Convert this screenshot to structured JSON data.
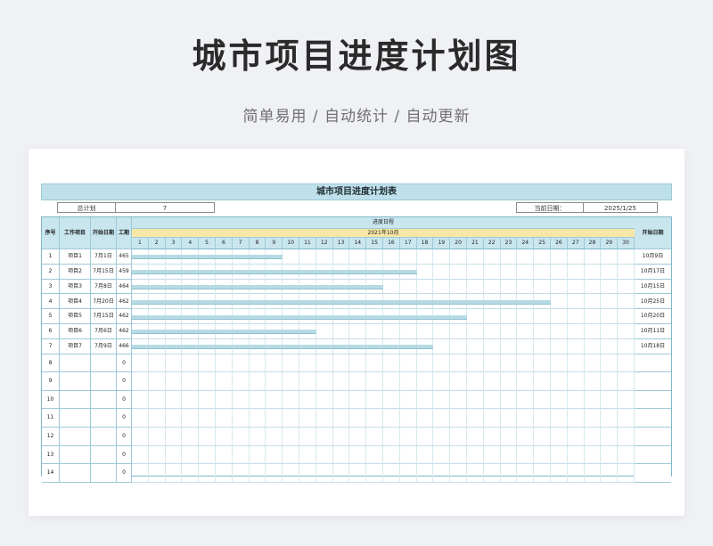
{
  "hero": {
    "title": "城市项目进度计划图",
    "subtitle": "简单易用 / 自动统计 / 自动更新"
  },
  "sheet": {
    "title": "城市项目进度计划表",
    "total_label": "总计划",
    "total_value": "7",
    "current_date_label": "当前日期：",
    "current_date_value": "2025/1/25"
  },
  "table": {
    "headers": {
      "seq": "序号",
      "task": "工作项目",
      "start": "开始日期",
      "duration": "工期",
      "progress": "进度日程",
      "month": "2021年10月",
      "end": "开始日期"
    },
    "days": [
      "1",
      "2",
      "3",
      "4",
      "5",
      "6",
      "7",
      "8",
      "9",
      "10",
      "11",
      "12",
      "13",
      "14",
      "15",
      "16",
      "17",
      "18",
      "19",
      "20",
      "21",
      "22",
      "23",
      "24",
      "25",
      "26",
      "27",
      "28",
      "29",
      "30"
    ],
    "rows": [
      {
        "seq": "1",
        "task": "项目1",
        "start": "7月1日",
        "duration": "465",
        "end": "10月9日",
        "bar_start": 1,
        "bar_end": 9
      },
      {
        "seq": "2",
        "task": "项目2",
        "start": "7月15日",
        "duration": "459",
        "end": "10月17日",
        "bar_start": 1,
        "bar_end": 17
      },
      {
        "seq": "3",
        "task": "项目3",
        "start": "7月8日",
        "duration": "464",
        "end": "10月15日",
        "bar_start": 1,
        "bar_end": 15
      },
      {
        "seq": "4",
        "task": "项目4",
        "start": "7月20日",
        "duration": "462",
        "end": "10月25日",
        "bar_start": 1,
        "bar_end": 25
      },
      {
        "seq": "5",
        "task": "项目5",
        "start": "7月15日",
        "duration": "462",
        "end": "10月20日",
        "bar_start": 1,
        "bar_end": 20
      },
      {
        "seq": "6",
        "task": "项目6",
        "start": "7月6日",
        "duration": "462",
        "end": "10月11日",
        "bar_start": 1,
        "bar_end": 11
      },
      {
        "seq": "7",
        "task": "项目7",
        "start": "7月9日",
        "duration": "466",
        "end": "10月18日",
        "bar_start": 1,
        "bar_end": 18
      },
      {
        "seq": "8",
        "task": "",
        "start": "",
        "duration": "0",
        "end": ""
      },
      {
        "seq": "9",
        "task": "",
        "start": "",
        "duration": "0",
        "end": ""
      },
      {
        "seq": "10",
        "task": "",
        "start": "",
        "duration": "0",
        "end": ""
      },
      {
        "seq": "11",
        "task": "",
        "start": "",
        "duration": "0",
        "end": ""
      },
      {
        "seq": "12",
        "task": "",
        "start": "",
        "duration": "0",
        "end": ""
      },
      {
        "seq": "13",
        "task": "",
        "start": "",
        "duration": "0",
        "end": ""
      },
      {
        "seq": "14",
        "task": "",
        "start": "",
        "duration": "0",
        "end": ""
      }
    ]
  }
}
